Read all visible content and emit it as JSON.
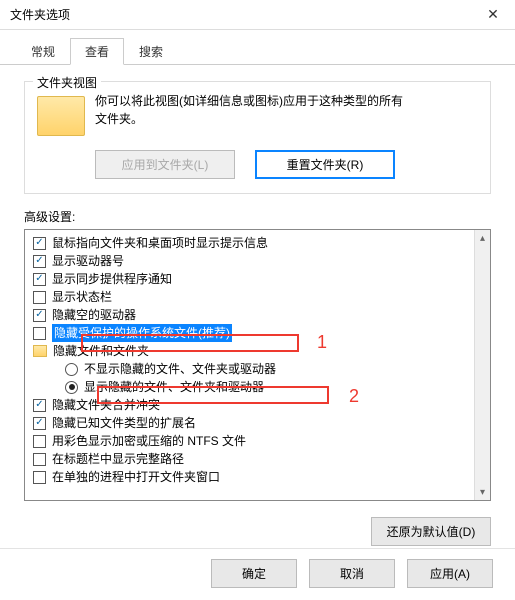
{
  "titlebar": {
    "title": "文件夹选项"
  },
  "tabs": {
    "general": "常规",
    "view": "查看",
    "search": "搜索"
  },
  "folderview": {
    "legend": "文件夹视图",
    "desc1": "你可以将此视图(如详细信息或图标)应用于这种类型的所有",
    "desc2": "文件夹。",
    "apply_btn": "应用到文件夹(L)",
    "reset_btn": "重置文件夹(R)"
  },
  "advanced": {
    "label": "高级设置:",
    "items": [
      {
        "type": "check",
        "checked": true,
        "indent": 0,
        "highlight": false,
        "text": "鼠标指向文件夹和桌面项时显示提示信息"
      },
      {
        "type": "check",
        "checked": true,
        "indent": 0,
        "highlight": false,
        "text": "显示驱动器号"
      },
      {
        "type": "check",
        "checked": true,
        "indent": 0,
        "highlight": false,
        "text": "显示同步提供程序通知"
      },
      {
        "type": "check",
        "checked": false,
        "indent": 0,
        "highlight": false,
        "text": "显示状态栏"
      },
      {
        "type": "check",
        "checked": true,
        "indent": 0,
        "highlight": false,
        "text": "隐藏空的驱动器"
      },
      {
        "type": "check",
        "checked": false,
        "indent": 0,
        "highlight": true,
        "text": "隐藏受保护的操作系统文件(推荐)"
      },
      {
        "type": "folder",
        "indent": 0,
        "highlight": false,
        "text": "隐藏文件和文件夹"
      },
      {
        "type": "radio",
        "checked": false,
        "indent": 2,
        "highlight": false,
        "text": "不显示隐藏的文件、文件夹或驱动器"
      },
      {
        "type": "radio",
        "checked": true,
        "indent": 2,
        "highlight": false,
        "text": "显示隐藏的文件、文件夹和驱动器"
      },
      {
        "type": "check",
        "checked": true,
        "indent": 0,
        "highlight": false,
        "text": "隐藏文件夹合并冲突"
      },
      {
        "type": "check",
        "checked": true,
        "indent": 0,
        "highlight": false,
        "text": "隐藏已知文件类型的扩展名"
      },
      {
        "type": "check",
        "checked": false,
        "indent": 0,
        "highlight": false,
        "text": "用彩色显示加密或压缩的 NTFS 文件"
      },
      {
        "type": "check",
        "checked": false,
        "indent": 0,
        "highlight": false,
        "text": "在标题栏中显示完整路径"
      },
      {
        "type": "check",
        "checked": false,
        "indent": 0,
        "highlight": false,
        "text": "在单独的进程中打开文件夹窗口"
      }
    ],
    "annotations": {
      "one": "1",
      "two": "2"
    }
  },
  "restore_btn": "还原为默认值(D)",
  "footer": {
    "ok": "确定",
    "cancel": "取消",
    "apply": "应用(A)"
  }
}
